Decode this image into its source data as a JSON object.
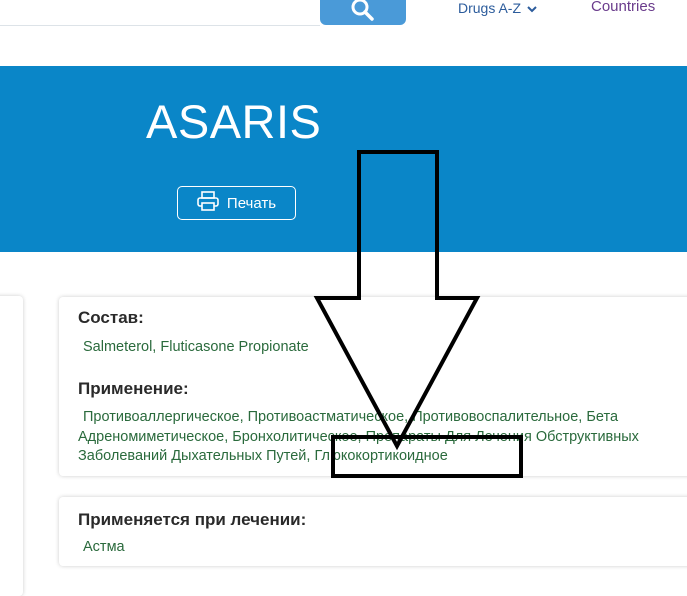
{
  "nav": {
    "drugs_label": "Drugs A-Z",
    "countries_label": "Countries"
  },
  "drug": {
    "title": "ASARIS",
    "print_label": "Печать"
  },
  "composition": {
    "label": "Состав:",
    "value": "Salmeterol, Fluticasone Propionate"
  },
  "usage": {
    "label": "Применение:",
    "line1": "Противоаллергическое, Противоастматическое, Противовоспалительное, Бета",
    "line2": "Адреномиметическое, Бронхолитическое, Препараты Для Лечения Обструктивных",
    "line3_prefix": "Заболеваний Дыхательных Путей,",
    "highlighted": "Глюкокортикоидное"
  },
  "treatment": {
    "label": "Применяется при лечении:",
    "value": "Астма"
  },
  "colors": {
    "hero_bg": "#0a86c8",
    "search_btn": "#4a9ad8",
    "value_text": "#2a6a3c",
    "annotation": "#000000"
  },
  "icons": [
    "search-icon",
    "chevron-down-icon",
    "printer-icon",
    "down-arrow-annotation"
  ]
}
